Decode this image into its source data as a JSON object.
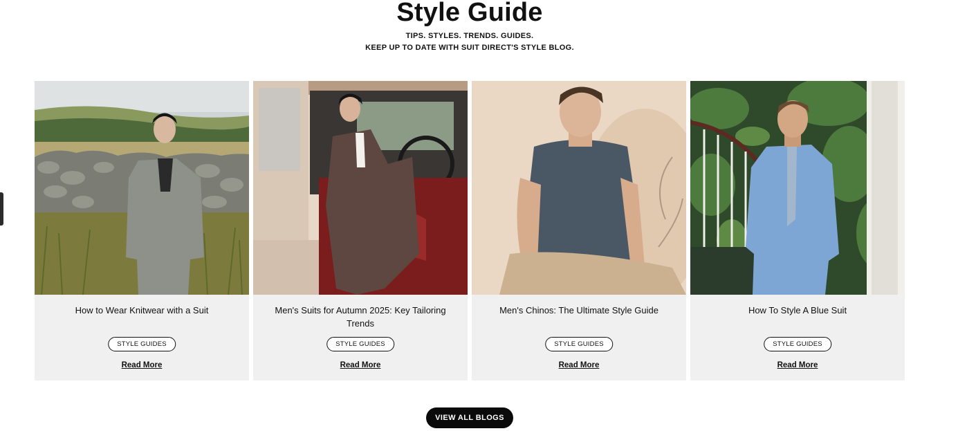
{
  "header": {
    "title": "Style Guide",
    "tagline_1": "TIPS. STYLES. TRENDS. GUIDES.",
    "tagline_2": "KEEP UP TO DATE WITH SUIT DIRECT'S STYLE BLOG."
  },
  "cards": [
    {
      "title": "How to Wear Knitwear with a Suit",
      "tag": "STYLE GUIDES",
      "link": "Read More"
    },
    {
      "title": "Men's Suits for Autumn 2025: Key Tailoring Trends",
      "tag": "STYLE GUIDES",
      "link": "Read More"
    },
    {
      "title": "Men's Chinos: The Ultimate Style Guide",
      "tag": "STYLE GUIDES",
      "link": "Read More"
    },
    {
      "title": "How To Style A Blue Suit",
      "tag": "STYLE GUIDES",
      "link": "Read More"
    }
  ],
  "footer": {
    "view_all_label": "VIEW ALL BLOGS"
  },
  "colors": {
    "card_bg": "#f0f0f0",
    "button_bg": "#0a0a0a",
    "text": "#111111"
  }
}
